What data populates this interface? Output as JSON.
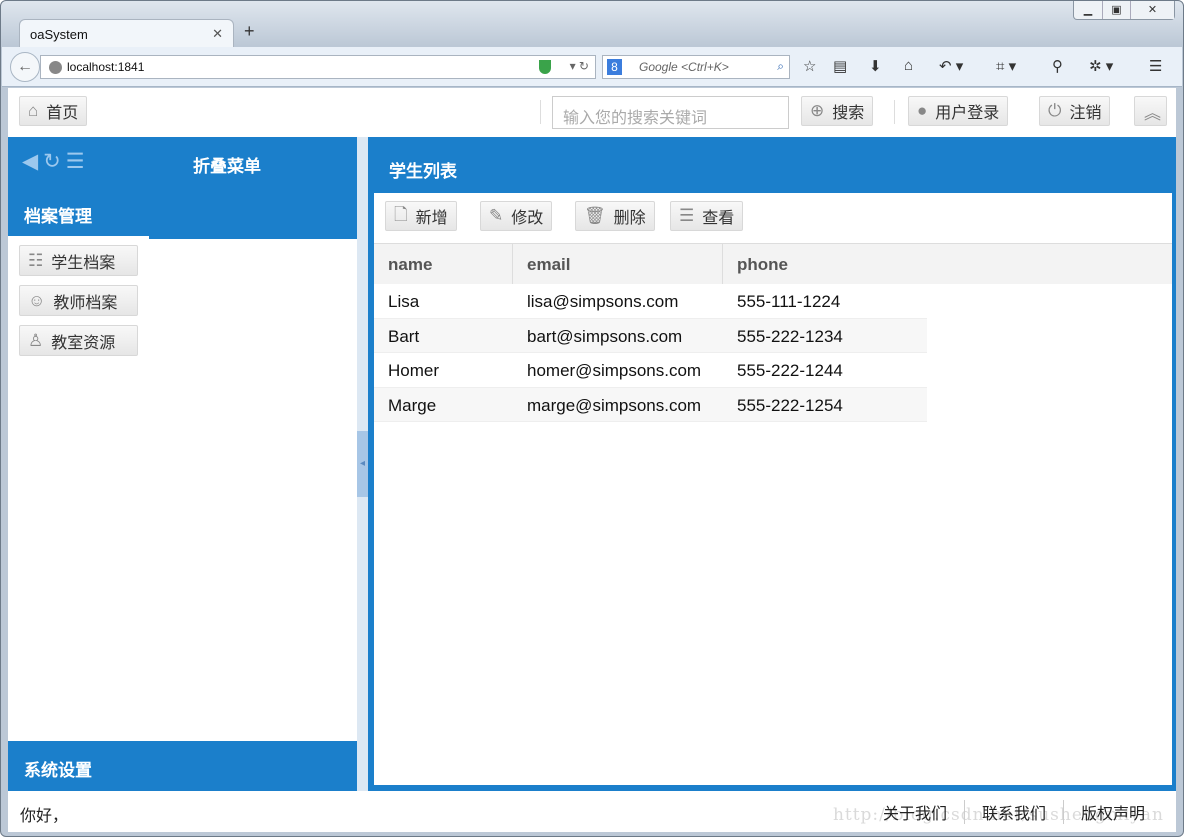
{
  "browser": {
    "tab_title": "oaSystem",
    "url": "localhost:1841",
    "search_placeholder": "Google <Ctrl+K>"
  },
  "topbar": {
    "home": "首页",
    "search_placeholder": "输入您的搜索关键词",
    "search": "搜索",
    "login": "用户登录",
    "logout": "注销"
  },
  "west": {
    "title": "折叠菜单",
    "section": "档案管理",
    "items": [
      {
        "label": "学生档案",
        "icon": "list-icon"
      },
      {
        "label": "教师档案",
        "icon": "face-icon"
      },
      {
        "label": "教室资源",
        "icon": "person-icon"
      }
    ],
    "bottom_section": "系统设置"
  },
  "center": {
    "title": "学生列表",
    "toolbar": {
      "add": "新增",
      "edit": "修改",
      "delete": "删除",
      "view": "查看"
    },
    "columns": [
      "name",
      "email",
      "phone"
    ],
    "rows": [
      {
        "name": "Lisa",
        "email": "lisa@simpsons.com",
        "phone": "555-111-1224"
      },
      {
        "name": "Bart",
        "email": "bart@simpsons.com",
        "phone": "555-222-1234"
      },
      {
        "name": "Homer",
        "email": "homer@simpsons.com",
        "phone": "555-222-1244"
      },
      {
        "name": "Marge",
        "email": "marge@simpsons.com",
        "phone": "555-222-1254"
      }
    ]
  },
  "footer": {
    "greeting": "你好，",
    "links": [
      "关于我们",
      "联系我们",
      "版权声明"
    ],
    "watermark": "http://blog.csdn.net/sushengmiyan"
  },
  "colors": {
    "primary": "#1b7fcb"
  }
}
